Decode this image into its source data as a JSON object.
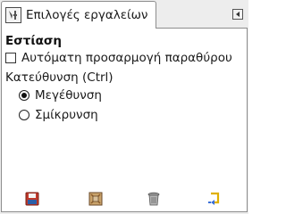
{
  "tab": {
    "title": "Επιλογές εργαλείων",
    "icon": "tool-options-icon",
    "menu_icon": "tab-menu-icon"
  },
  "options": {
    "section_title": "Εστίαση",
    "auto_resize": {
      "label": "Αυτόματη προσαρμογή παραθύρου",
      "checked": false
    },
    "direction": {
      "label": "Κατεύθυνση (Ctrl)",
      "choices": [
        {
          "label": "Μεγέθυνση",
          "selected": true
        },
        {
          "label": "Σμίκρυνση",
          "selected": false
        }
      ]
    }
  },
  "toolbar": {
    "buttons": [
      {
        "icon": "save-icon",
        "color": "#c0392b"
      },
      {
        "icon": "restore-icon",
        "color": "#6a4a2a"
      },
      {
        "icon": "delete-icon",
        "color": "#777777"
      },
      {
        "icon": "reset-icon",
        "color": "#e0b000"
      }
    ]
  }
}
